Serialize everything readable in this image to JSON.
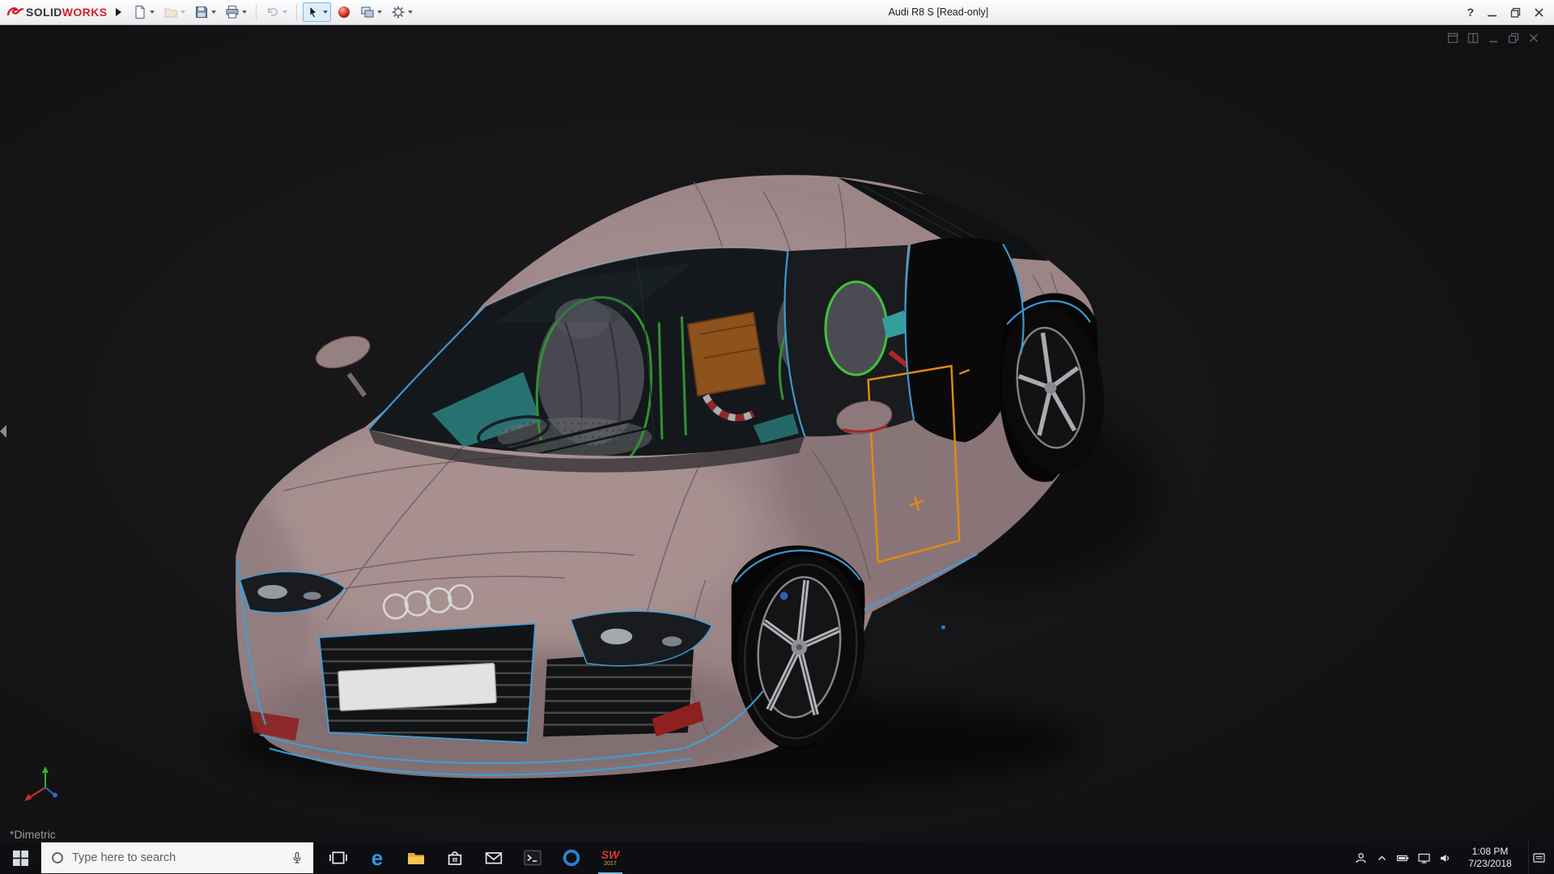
{
  "titlebar": {
    "brand": {
      "solid": "SOLID",
      "works": "WORKS"
    },
    "title": "Audi R8 S [Read-only]",
    "help_glyph": "?"
  },
  "toolbar": {
    "icons": [
      "new-document",
      "open",
      "save",
      "print",
      "undo",
      "select",
      "appearance",
      "display-style",
      "options"
    ]
  },
  "doc_window": {
    "controls": [
      "new-window",
      "split",
      "minimize",
      "restore",
      "close"
    ]
  },
  "viewport": {
    "orientation_label": "*Dimetric",
    "model": "Audi R8 S 3D CAD model",
    "highlight_colors": {
      "edges": "#3f9fd8",
      "selection": "#e08a12",
      "frames": "#3fc13c"
    },
    "body_color": "#9b8587"
  },
  "taskbar": {
    "search_placeholder": "Type here to search",
    "apps": [
      "task-view",
      "edge",
      "file-explorer",
      "store",
      "mail",
      "console",
      "media",
      "solidworks"
    ],
    "edge_glyph": "e",
    "solidworks": {
      "letters": "SW",
      "year": "2017"
    },
    "tray": {
      "time": "1:08 PM",
      "date": "7/23/2018"
    }
  }
}
